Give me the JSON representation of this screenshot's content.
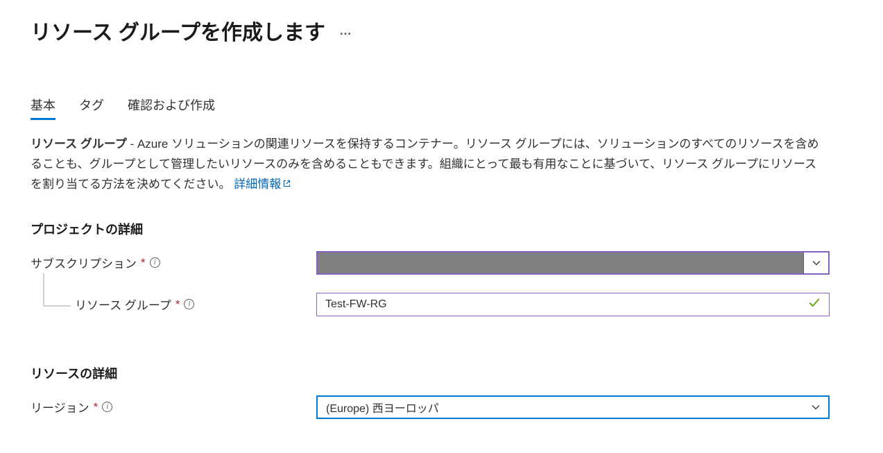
{
  "header": {
    "title": "リソース グループを作成します",
    "more": "…"
  },
  "tabs": {
    "basic": "基本",
    "tags": "タグ",
    "review": "確認および作成"
  },
  "description": {
    "lead": "リソース グループ",
    "body": " - Azure ソリューションの関連リソースを保持するコンテナー。リソース グループには、ソリューションのすべてのリソースを含めることも、グループとして管理したいリソースのみを含めることもできます。組織にとって最も有用なことに基づいて、リソース グループにリソースを割り当てる方法を決めてください。 ",
    "link": "詳細情報"
  },
  "sections": {
    "project_details": "プロジェクトの詳細",
    "resource_details": "リソースの詳細"
  },
  "fields": {
    "subscription": {
      "label": "サブスクリプション",
      "value": ""
    },
    "resource_group": {
      "label": "リソース グループ",
      "value": "Test-FW-RG"
    },
    "region": {
      "label": "リージョン",
      "value": "(Europe) 西ヨーロッパ"
    }
  },
  "symbols": {
    "required": "*",
    "info": "i"
  }
}
